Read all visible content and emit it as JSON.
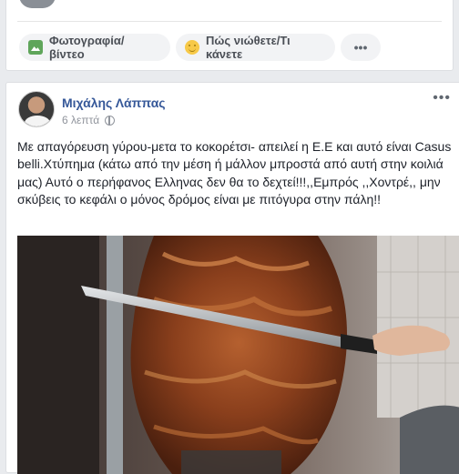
{
  "composer": {
    "photo_label": "Φωτογραφία/βίντεο",
    "feeling_label": "Πώς νιώθετε/Τι κάνετε",
    "more_label": "•••"
  },
  "post": {
    "author": "Μιχάλης Λάππας",
    "timestamp": "6 λεπτά",
    "menu_label": "•••",
    "text": "Με απαγόρευση γύρου-μετα το κοκορέτσι- απειλεί η Ε.Ε και αυτό είναι Casus belli.Χτύπημα (κάτω από την μέση ή μάλλον μπροστά από αυτή στην κοιλιά μας) Αυτό ο περήφανος Ελληνας δεν θα το δεχτεί!!!,,Εμπρός ,,Χοντρέ,, μην σκύβεις το κεφάλι ο μόνος δρόμος είναι με πιτόγυρα στην πάλη!!"
  },
  "colors": {
    "link": "#365899",
    "page_bg": "#e9ebee",
    "muted": "#90949c"
  }
}
